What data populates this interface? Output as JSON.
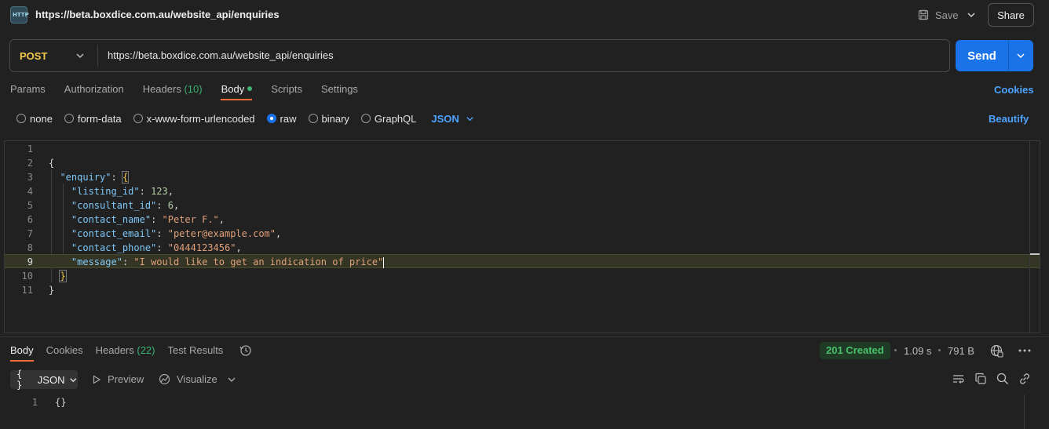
{
  "request": {
    "title": "https://beta.boxdice.com.au/website_api/enquiries",
    "http_badge": "HTTP",
    "save_label": "Save",
    "share_label": "Share",
    "method": "POST",
    "url": "https://beta.boxdice.com.au/website_api/enquiries",
    "send_label": "Send"
  },
  "tabs": {
    "params": "Params",
    "authorization": "Authorization",
    "headers": "Headers",
    "headers_count": "(10)",
    "body": "Body",
    "scripts": "Scripts",
    "settings": "Settings",
    "cookies": "Cookies"
  },
  "body_types": {
    "none": "none",
    "form_data": "form-data",
    "urlencoded": "x-www-form-urlencoded",
    "raw": "raw",
    "binary": "binary",
    "graphql": "GraphQL",
    "selected": "raw",
    "language": "JSON",
    "beautify": "Beautify"
  },
  "editor": {
    "line_numbers": [
      "1",
      "2",
      "3",
      "4",
      "5",
      "6",
      "7",
      "8",
      "9",
      "10",
      "11"
    ],
    "active_line": 9,
    "tokens": {
      "open_brace": "{",
      "enquiry_key": "\"enquiry\"",
      "colon": ": ",
      "inner_open": "{",
      "listing_id_key": "\"listing_id\"",
      "listing_id_val": "123",
      "consultant_id_key": "\"consultant_id\"",
      "consultant_id_val": "6",
      "contact_name_key": "\"contact_name\"",
      "contact_name_val": "\"Peter F.\"",
      "contact_email_key": "\"contact_email\"",
      "contact_email_val": "\"peter@example.com\"",
      "contact_phone_key": "\"contact_phone\"",
      "contact_phone_val": "\"0444123456\"",
      "message_key": "\"message\"",
      "message_val": "\"I would like to get an indication of price\"",
      "inner_close": "}",
      "close_brace": "}",
      "comma": ","
    }
  },
  "response": {
    "tabs": {
      "body": "Body",
      "cookies": "Cookies",
      "headers": "Headers",
      "headers_count": "(22)",
      "test_results": "Test Results"
    },
    "status": "201 Created",
    "time": "1.09 s",
    "size": "791 B",
    "format": "JSON",
    "preview": "Preview",
    "visualize": "Visualize",
    "line_number": "1",
    "content": "{}"
  },
  "colors": {
    "accent": "#ff6c37",
    "send": "#1a73e8",
    "link": "#4da3ff",
    "method": "#f2c94c",
    "success": "#49c26c"
  }
}
